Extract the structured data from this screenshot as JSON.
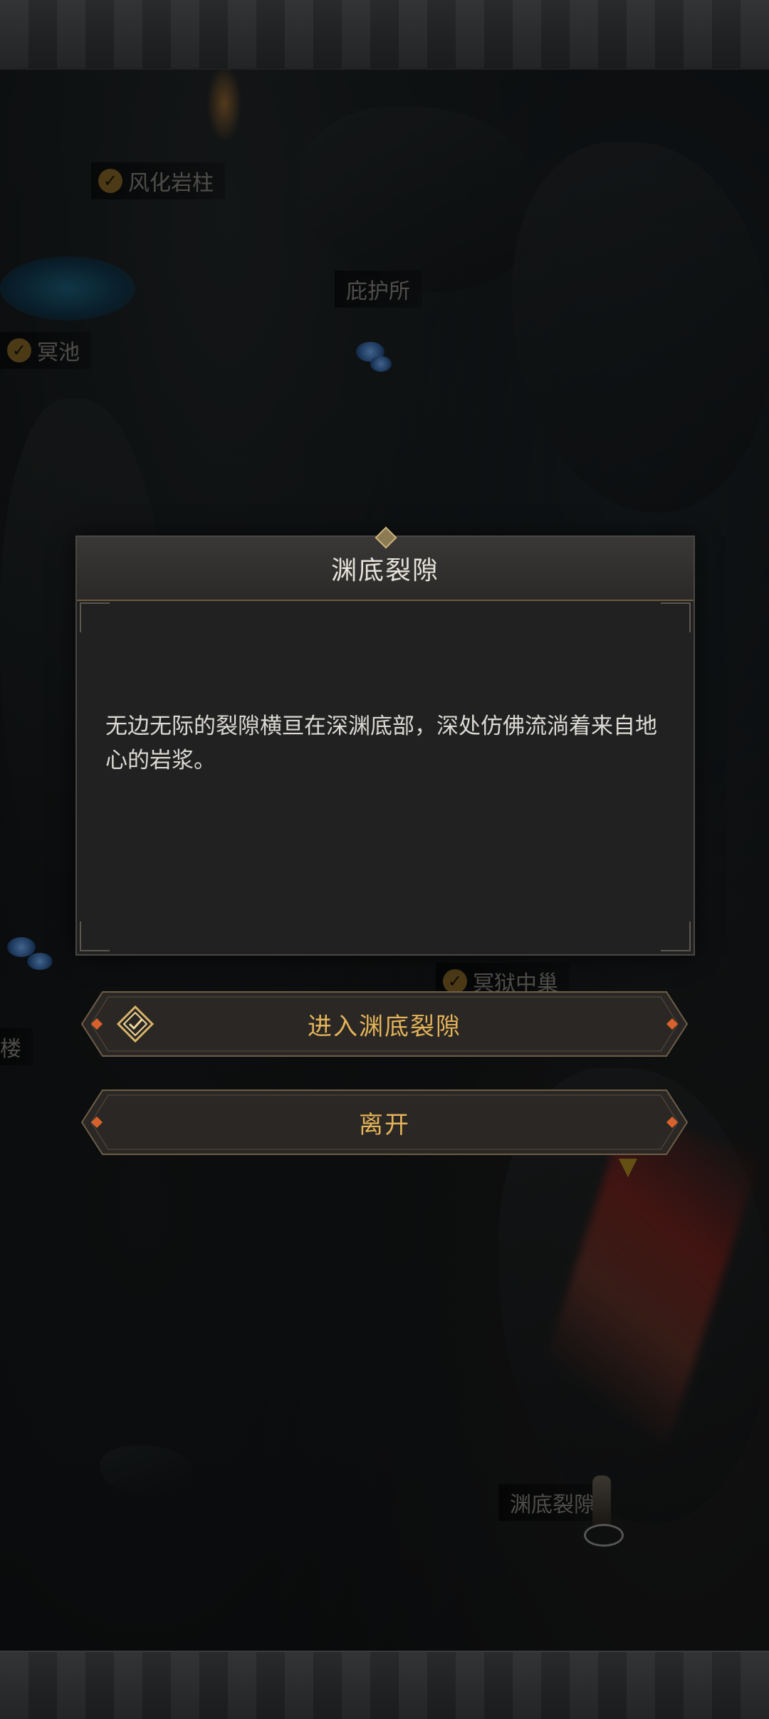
{
  "map": {
    "labels": [
      {
        "text": "风化岩柱",
        "checked": true
      },
      {
        "text": "庇护所",
        "checked": false
      },
      {
        "text": "冥池",
        "checked": true
      },
      {
        "text": "冥狱中巢",
        "checked": true
      },
      {
        "text": "楼",
        "checked": false
      },
      {
        "text": "渊底裂隙",
        "checked": false
      }
    ]
  },
  "dialog": {
    "title": "渊底裂隙",
    "description": "无边无际的裂隙横亘在深渊底部，深处仿佛流淌着来自地心的岩浆。"
  },
  "actions": {
    "enter_label": "进入渊底裂隙",
    "leave_label": "离开"
  },
  "colors": {
    "accent_gold": "#e3b35a",
    "button_border": "#6e5e48",
    "lava": "#c9301f"
  }
}
